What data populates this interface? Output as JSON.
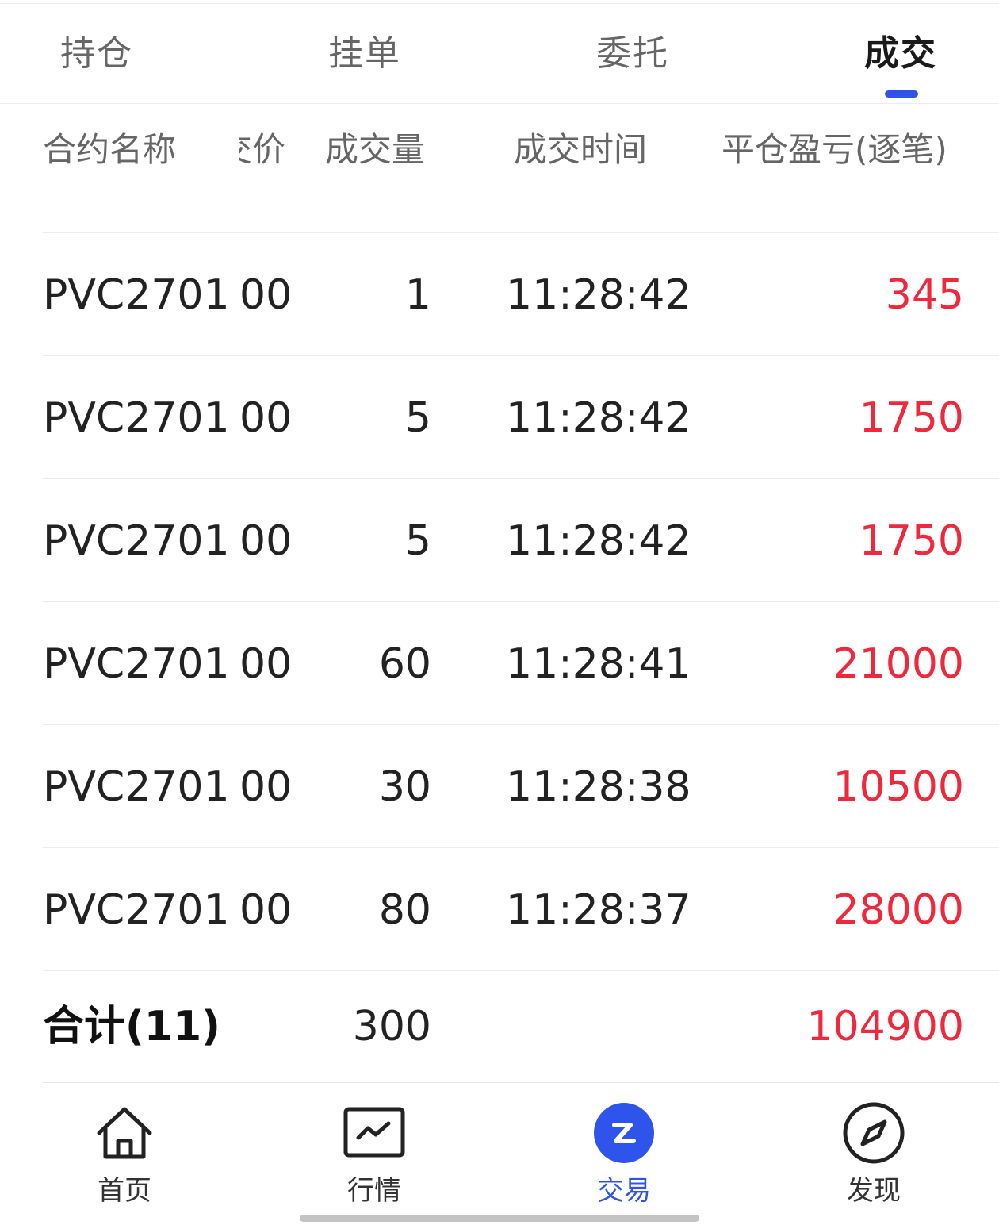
{
  "tabs": [
    {
      "label": "持仓"
    },
    {
      "label": "挂单"
    },
    {
      "label": "委托"
    },
    {
      "label": "成交"
    }
  ],
  "active_tab": "成交",
  "table": {
    "headers": {
      "name": "合约名称",
      "price": "成交价",
      "qty": "成交量",
      "time": "成交时间",
      "pnl": "平仓盈亏(逐笔)"
    },
    "rows": [
      {
        "name": "PVC2701",
        "price": "00",
        "qty": "1",
        "time": "11:28:42",
        "pnl": "345"
      },
      {
        "name": "PVC2701",
        "price": "00",
        "qty": "5",
        "time": "11:28:42",
        "pnl": "1750"
      },
      {
        "name": "PVC2701",
        "price": "00",
        "qty": "5",
        "time": "11:28:42",
        "pnl": "1750"
      },
      {
        "name": "PVC2701",
        "price": "00",
        "qty": "60",
        "time": "11:28:41",
        "pnl": "21000"
      },
      {
        "name": "PVC2701",
        "price": "00",
        "qty": "30",
        "time": "11:28:38",
        "pnl": "10500"
      },
      {
        "name": "PVC2701",
        "price": "00",
        "qty": "80",
        "time": "11:28:37",
        "pnl": "28000"
      }
    ],
    "total": {
      "label": "合计(11)",
      "qty": "300",
      "pnl": "104900"
    }
  },
  "bottom_nav": [
    {
      "label": "首页",
      "icon": "home-icon"
    },
    {
      "label": "行情",
      "icon": "chart-icon"
    },
    {
      "label": "交易",
      "icon": "trade-icon"
    },
    {
      "label": "发现",
      "icon": "compass-icon"
    }
  ],
  "colors": {
    "accent": "#2f54eb",
    "profit": "#f0283c",
    "text": "#222222",
    "muted": "#666666"
  }
}
